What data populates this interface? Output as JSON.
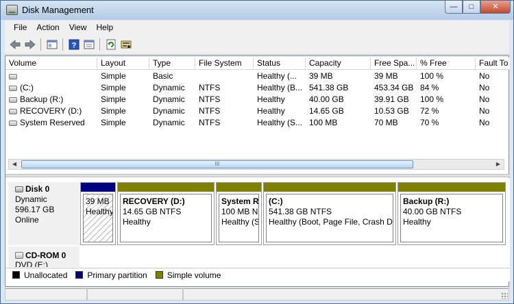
{
  "window": {
    "title": "Disk Management"
  },
  "menu": [
    "File",
    "Action",
    "View",
    "Help"
  ],
  "toolbar": {
    "buttons": [
      "back-arrow-icon",
      "forward-arrow-icon",
      "console-tree-icon",
      "help-icon",
      "properties-icon",
      "refresh-icon",
      "rescan-disks-icon"
    ]
  },
  "columns": [
    "Volume",
    "Layout",
    "Type",
    "File System",
    "Status",
    "Capacity",
    "Free Spa...",
    "% Free",
    "Fault To"
  ],
  "volumes": [
    {
      "volume": "",
      "layout": "Simple",
      "type": "Basic",
      "fs": "",
      "status": "Healthy (...",
      "capacity": "39 MB",
      "free": "39 MB",
      "pct": "100 %",
      "fault": "No"
    },
    {
      "volume": "(C:)",
      "layout": "Simple",
      "type": "Dynamic",
      "fs": "NTFS",
      "status": "Healthy (B...",
      "capacity": "541.38 GB",
      "free": "453.34 GB",
      "pct": "84 %",
      "fault": "No"
    },
    {
      "volume": "Backup (R:)",
      "layout": "Simple",
      "type": "Dynamic",
      "fs": "NTFS",
      "status": "Healthy",
      "capacity": "40.00 GB",
      "free": "39.91 GB",
      "pct": "100 %",
      "fault": "No"
    },
    {
      "volume": "RECOVERY (D:)",
      "layout": "Simple",
      "type": "Dynamic",
      "fs": "NTFS",
      "status": "Healthy",
      "capacity": "14.65 GB",
      "free": "10.53 GB",
      "pct": "72 %",
      "fault": "No"
    },
    {
      "volume": "System Reserved",
      "layout": "Simple",
      "type": "Dynamic",
      "fs": "NTFS",
      "status": "Healthy (S...",
      "capacity": "100 MB",
      "free": "70 MB",
      "pct": "70 %",
      "fault": "No"
    }
  ],
  "scrollbar": {
    "grip": "III"
  },
  "disk0": {
    "name": "Disk 0",
    "kind": "Dynamic",
    "size": "596.17 GB",
    "state": "Online",
    "partitions": [
      {
        "title": "",
        "line1": "39 MB",
        "line2": "Healthy",
        "bar_color": "#000080"
      },
      {
        "title": "RECOVERY  (D:)",
        "line1": "14.65 GB NTFS",
        "line2": "Healthy",
        "bar_color": "#808000"
      },
      {
        "title": "System R",
        "line1": "100 MB N",
        "line2": "Healthy (S",
        "bar_color": "#808000"
      },
      {
        "title": "(C:)",
        "line1": "541.38 GB NTFS",
        "line2": "Healthy (Boot, Page File, Crash Dui",
        "bar_color": "#808000"
      },
      {
        "title": "Backup  (R:)",
        "line1": "40.00 GB NTFS",
        "line2": "Healthy",
        "bar_color": "#808000"
      }
    ]
  },
  "cdrom": {
    "name": "CD-ROM 0",
    "sub": "DVD (E:)"
  },
  "legend": [
    {
      "label": "Unallocated",
      "color": "#000000"
    },
    {
      "label": "Primary partition",
      "color": "#000080"
    },
    {
      "label": "Simple volume",
      "color": "#808000"
    }
  ],
  "colors": {
    "primary": "#000080",
    "simple": "#808000",
    "unallocated": "#000000"
  }
}
